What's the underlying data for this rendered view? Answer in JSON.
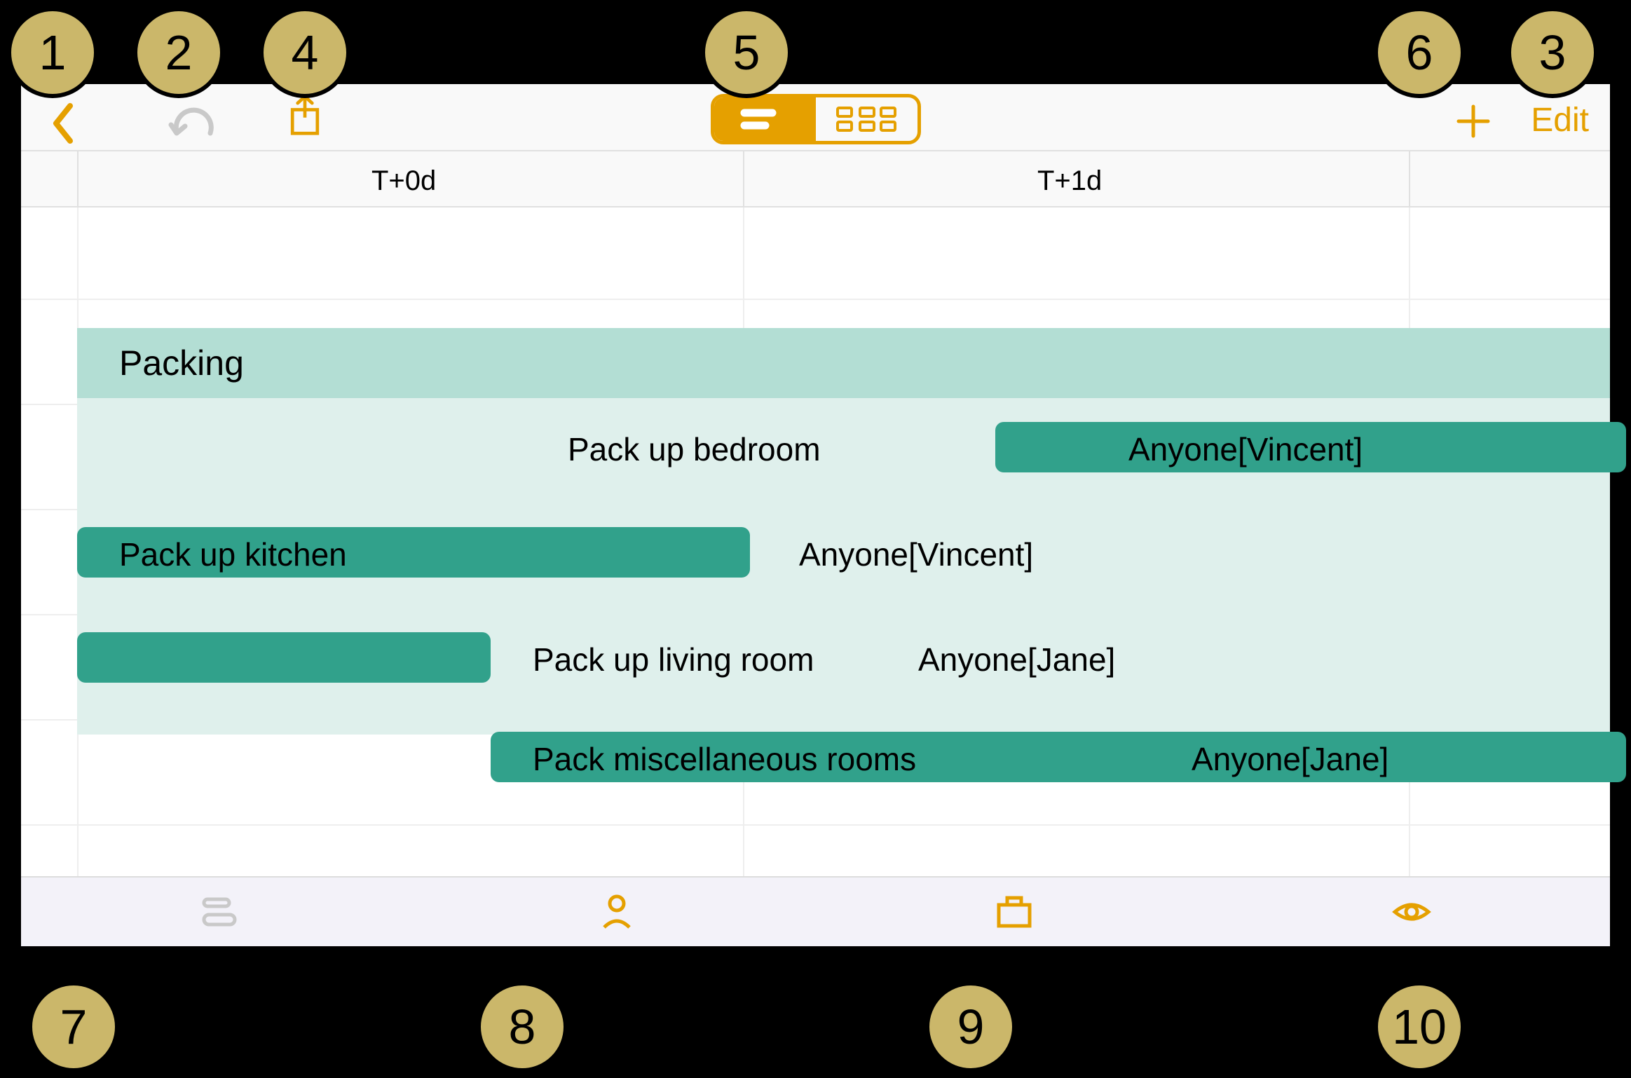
{
  "toolbar": {
    "edit_label": "Edit",
    "segmented": {
      "active": "list",
      "inactive": "tree"
    }
  },
  "timeline": {
    "columns": [
      {
        "label": "T+0d"
      },
      {
        "label": "T+1d"
      }
    ]
  },
  "gantt": {
    "group_title": "Packing",
    "tasks": [
      {
        "label": "Pack up bedroom",
        "assignee": "Anyone[Vincent]"
      },
      {
        "label": "Pack up kitchen",
        "assignee": "Anyone[Vincent]"
      },
      {
        "label": "Pack up living room",
        "assignee": "Anyone[Jane]"
      },
      {
        "label": "Pack miscellaneous rooms",
        "assignee": "Anyone[Jane]"
      }
    ]
  },
  "annotations": [
    "1",
    "2",
    "3",
    "4",
    "5",
    "6",
    "7",
    "8",
    "9",
    "10"
  ],
  "chart_data": {
    "type": "bar",
    "orientation": "horizontal_gantt",
    "title": "Packing",
    "x_unit": "days",
    "x_tick_labels": [
      "T+0d",
      "T+1d"
    ],
    "x_range": [
      0,
      2
    ],
    "series": [
      {
        "name": "Pack up bedroom",
        "assignee": "Anyone[Vincent]",
        "start": 0.75,
        "end": 2.0
      },
      {
        "name": "Pack up kitchen",
        "assignee": "Anyone[Vincent]",
        "start": 0.0,
        "end": 0.55
      },
      {
        "name": "Pack up living room",
        "assignee": "Anyone[Jane]",
        "start": 0.0,
        "end": 0.33
      },
      {
        "name": "Pack miscellaneous rooms",
        "assignee": "Anyone[Jane]",
        "start": 0.33,
        "end": 2.0
      }
    ]
  }
}
